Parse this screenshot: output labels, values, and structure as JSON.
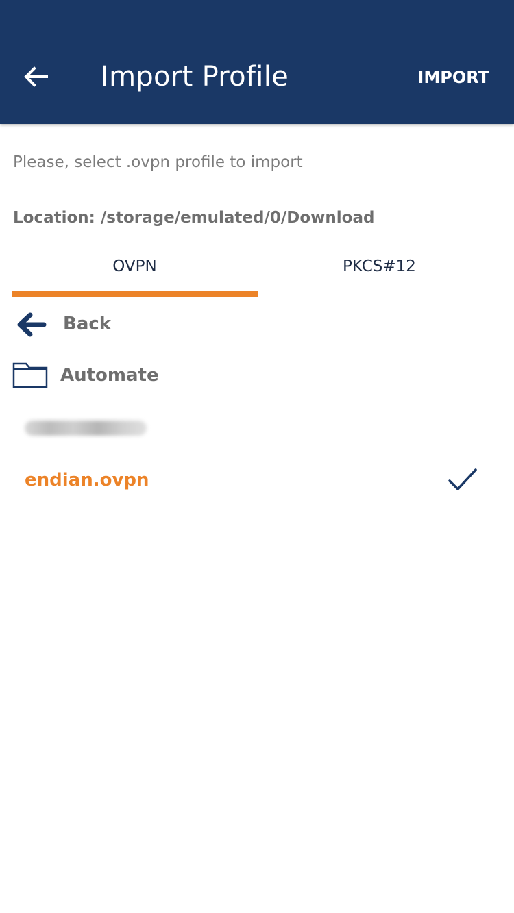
{
  "app_bar": {
    "title": "Import Profile",
    "action_label": "IMPORT",
    "back_icon": "arrow-left-icon",
    "background_color": "#1a3866"
  },
  "instruction": "Please, select .ovpn profile to import",
  "location": "Location: /storage/emulated/0/Download",
  "tabs": [
    {
      "label": "OVPN",
      "selected": true
    },
    {
      "label": "PKCS#12",
      "selected": false
    }
  ],
  "accent_color": "#ec8328",
  "file_list": {
    "back": {
      "label": "Back",
      "icon": "arrow-left-bold-icon"
    },
    "folder": {
      "label": "Automate",
      "icon": "folder-icon"
    },
    "blurred_item": {
      "redacted": true
    },
    "selected_file": {
      "label": "endian.ovpn",
      "icon": "checkmark-icon",
      "selected": true
    }
  }
}
